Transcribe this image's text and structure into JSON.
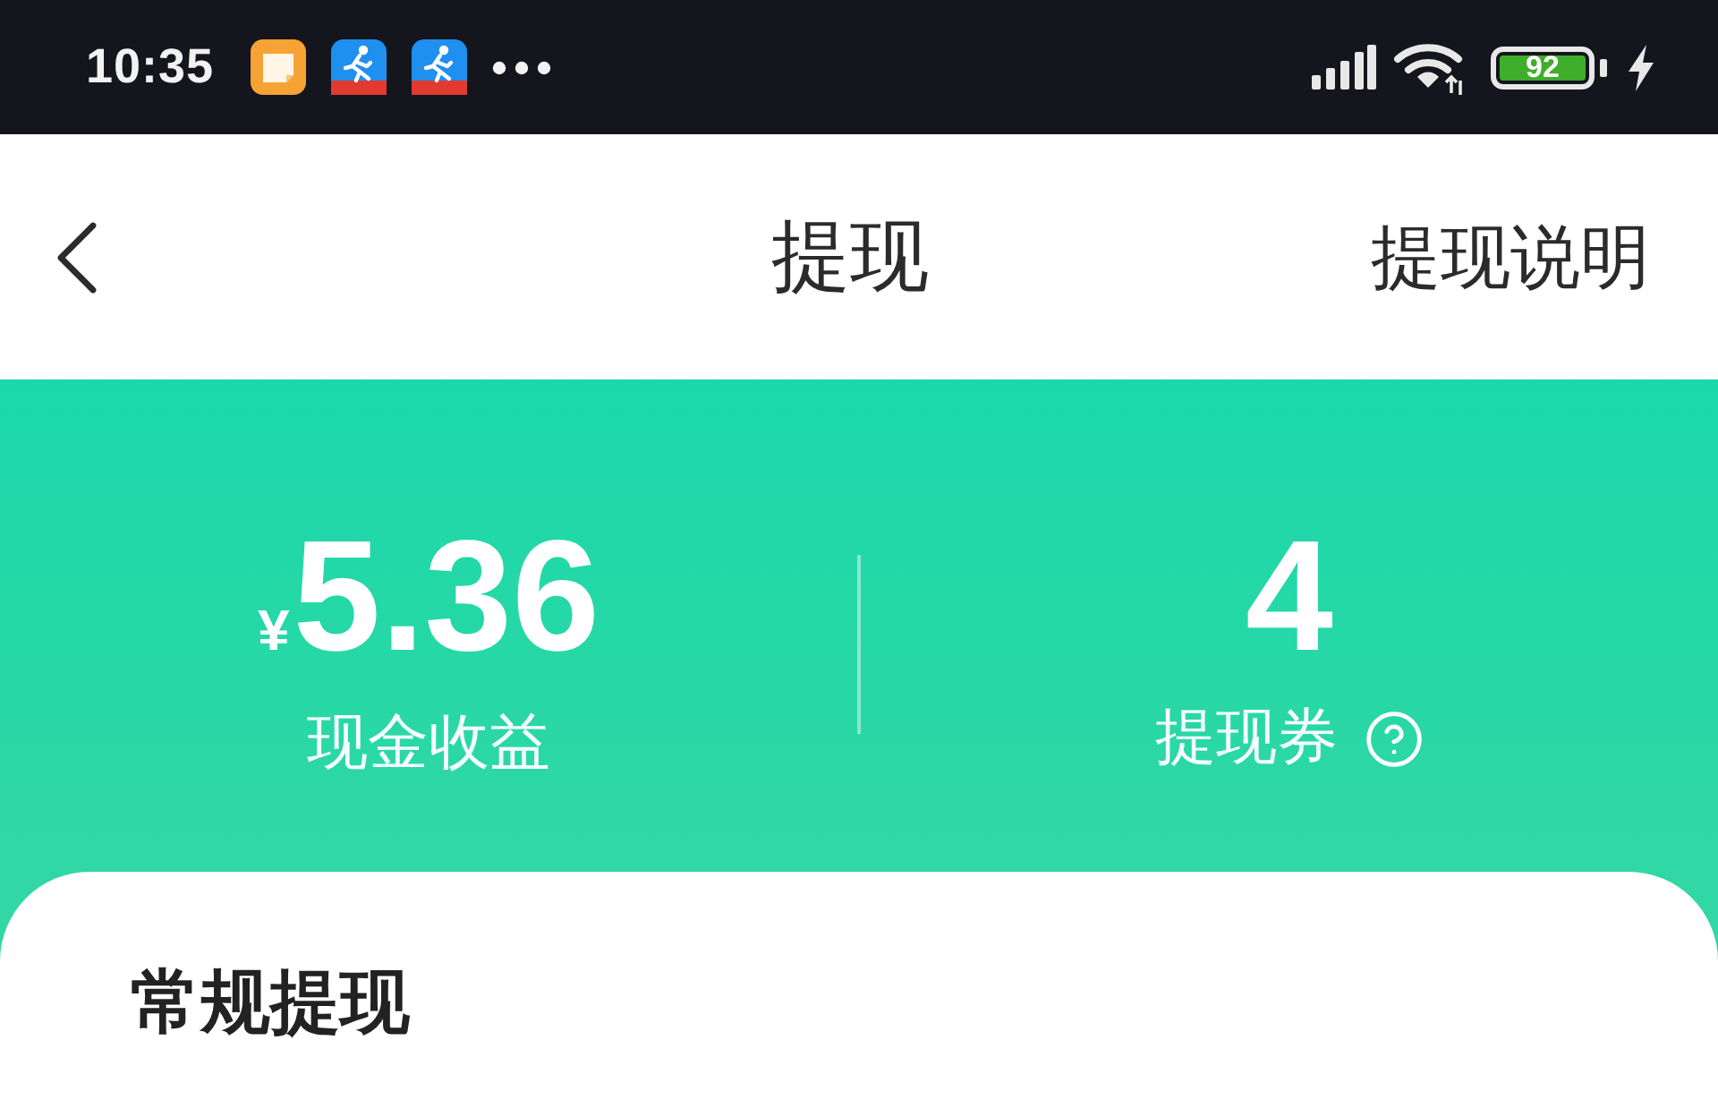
{
  "status_bar": {
    "time": "10:35",
    "battery": "92"
  },
  "nav": {
    "title": "提现",
    "action": "提现说明"
  },
  "summary": {
    "stats": [
      {
        "currency": "¥",
        "value": "5.36",
        "label": "现金收益",
        "help": false
      },
      {
        "value": "4",
        "label": "提现券",
        "help": true
      }
    ]
  },
  "section": {
    "title": "常规提现"
  }
}
